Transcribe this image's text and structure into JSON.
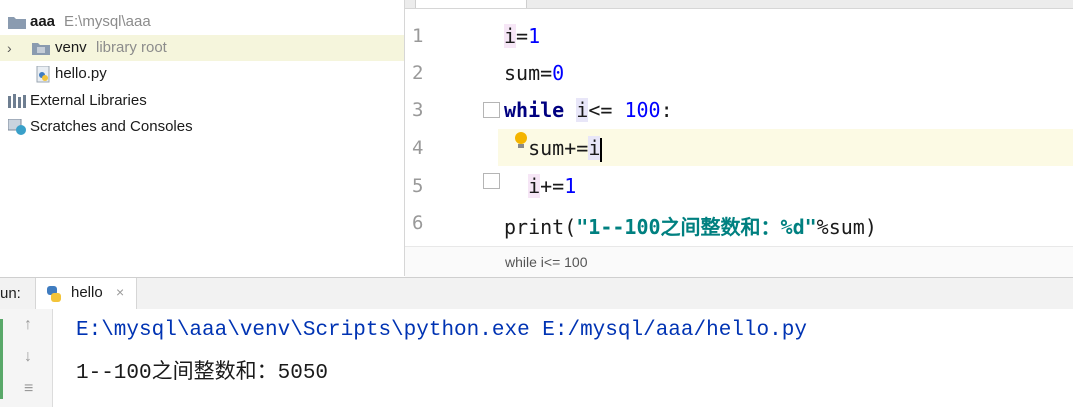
{
  "project": {
    "root_name": "aaa",
    "root_path": "E:\\mysql\\aaa",
    "venv_name": "venv",
    "venv_tag": "library root",
    "file_name": "hello.py",
    "external_libraries": "External Libraries",
    "scratches": "Scratches and Consoles"
  },
  "editor": {
    "line_numbers": [
      "1",
      "2",
      "3",
      "4",
      "5",
      "6"
    ],
    "code": {
      "l1_var": "i",
      "l1_rest": "=",
      "l1_num": "1",
      "l2_text": "sum=",
      "l2_num": "0",
      "l3_kw": "while",
      "l3_var": "i",
      "l3_op": "<=",
      "l3_num": "100",
      "l3_colon": ":",
      "l4_text": "sum+=",
      "l4_var": "i",
      "l5_var": "i",
      "l5_op": "+=",
      "l5_num": "1",
      "l6_func": "print(",
      "l6_str": "\"1--100之间整数和：%d\"",
      "l6_rest": "%sum)"
    },
    "breadcrumb": "while i<= 100"
  },
  "run": {
    "label": "un:",
    "tab_label": "hello",
    "tab_close": "×",
    "output_lines": [
      "E:\\mysql\\aaa\\venv\\Scripts\\python.exe E:/mysql/aaa/hello.py",
      "1--100之间整数和：5050"
    ]
  },
  "colors": {
    "keyword": "#000080",
    "number": "#0000ff",
    "string": "#008080",
    "current_line": "#fcfae4",
    "venv_highlight": "#f5f5dc"
  }
}
